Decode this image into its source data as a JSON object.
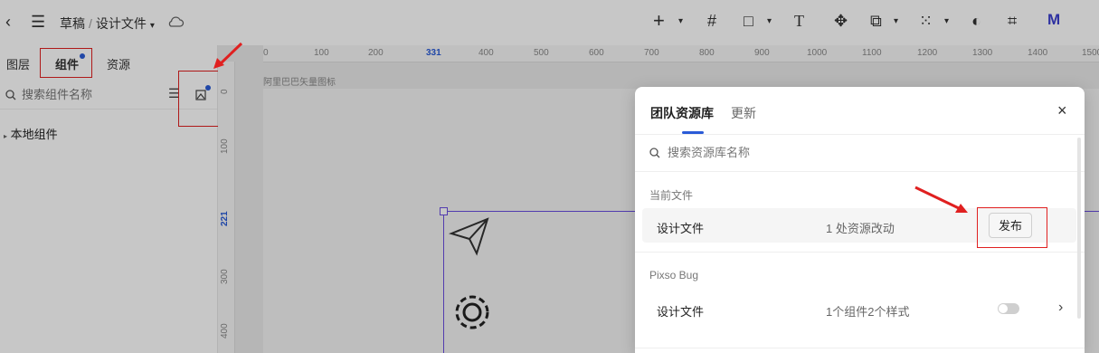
{
  "topbar": {
    "breadcrumb_parent": "草稿",
    "breadcrumb_sep": "/",
    "breadcrumb_current": "设计文件",
    "icons": [
      "back-icon",
      "menu-icon",
      "cloud-icon",
      "plus-icon",
      "frame-icon",
      "shape-icon",
      "text-icon",
      "component-icon",
      "boolean-icon",
      "mask-icon",
      "contrast-icon",
      "crop-icon",
      "plugin-icon"
    ]
  },
  "leftpanel": {
    "tabs": [
      "图层",
      "组件",
      "资源"
    ],
    "active_tab": "组件",
    "search_placeholder": "搜索组件名称",
    "local_components": "本地组件"
  },
  "canvas": {
    "ruler_top": [
      "0",
      "100",
      "200",
      "331",
      "400",
      "500",
      "600",
      "700",
      "800",
      "900",
      "1000",
      "1100",
      "1200",
      "1300",
      "1400",
      "1500"
    ],
    "ruler_left": [
      "0",
      "100",
      "221",
      "300",
      "400"
    ],
    "frame_label": "阿里巴巴矢量图标"
  },
  "modal": {
    "tabs": [
      "团队资源库",
      "更新"
    ],
    "search_placeholder": "搜索资源库名称",
    "current_file_section": "当前文件",
    "current_file_name": "设计文件",
    "current_file_status": "1 处资源改动",
    "publish_label": "发布",
    "library_section": "Pixso Bug",
    "library_file_name": "设计文件",
    "library_file_status": "1个组件2个样式"
  },
  "colors": {
    "accent": "#2a5bd7",
    "highlight": "#e02020"
  }
}
